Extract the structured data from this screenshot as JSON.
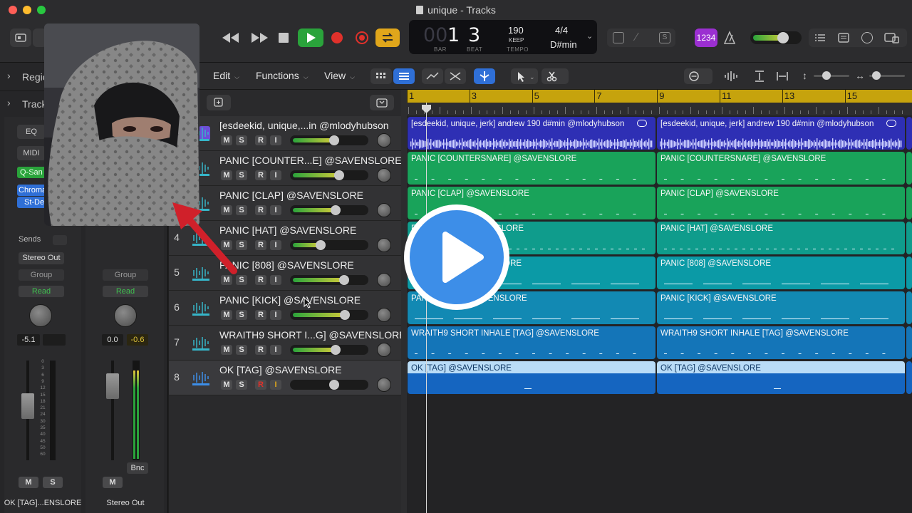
{
  "window": {
    "title": "unique - Tracks"
  },
  "transport": {
    "bar": "1",
    "beat": "3",
    "bar_label": "BAR",
    "beat_label": "BEAT",
    "tempo": "190",
    "tempo_mode": "KEEP",
    "tempo_label": "TEMPO",
    "signature": "4/4",
    "key": "D#min"
  },
  "lcd_toggle": {
    "label": "1234"
  },
  "menus": {
    "edit": "Edit",
    "functions": "Functions",
    "view": "View"
  },
  "inspector": {
    "region_header": "Regio",
    "track_header": "Track",
    "eq_label": "EQ",
    "midi_label": "MIDI",
    "qsampler_label": "Q-San",
    "chroma_label": "Chroma",
    "stdelay_label": "St-De",
    "sends_label": "Sends",
    "output_label": "Stereo Out",
    "group_label": "Group",
    "automation_left": "Read",
    "automation_right": "Read",
    "vol_left": "-5.1",
    "vol_right_a": "0.0",
    "vol_right_b": "-0.6",
    "mute_left": "M",
    "solo_left": "S",
    "mute_right": "M",
    "bounce": "Bnc",
    "strip_left_name": "OK [TAG]...ENSLORE",
    "strip_right_name": "Stereo Out",
    "meter_scale": [
      "0",
      "3",
      "6",
      "9",
      "12",
      "15",
      "18",
      "21",
      "24",
      "30",
      "35",
      "40",
      "45",
      "50",
      "60"
    ]
  },
  "tracks": [
    {
      "num": "",
      "name": "[esdeekid, unique,...in @mlodyhubson",
      "region": "[esdeekid, unique, jerk] andrew 190 d#min @mlodyhubson",
      "color": "#2e2fb4",
      "vol": 0.55
    },
    {
      "num": "",
      "name": "PANIC [COUNTER...E] @SAVENSLORE",
      "region": "PANIC [COUNTERSNARE] @SAVENSLORE",
      "color": "#19a35a",
      "vol": 0.62
    },
    {
      "num": "",
      "name": "PANIC [CLAP] @SAVENSLORE",
      "region": "PANIC [CLAP] @SAVENSLORE",
      "color": "#19a35a",
      "vol": 0.57
    },
    {
      "num": "4",
      "name": "PANIC [HAT] @SAVENSLORE",
      "region": "PANIC [HAT] @SAVENSLORE",
      "color": "#0f9c8c",
      "vol": 0.36
    },
    {
      "num": "5",
      "name": "PANIC [808] @SAVENSLORE",
      "region": "PANIC [808] @SAVENSLORE",
      "color": "#0b9aa6",
      "vol": 0.69
    },
    {
      "num": "6",
      "name": "PANIC [KICK] @SAVENSLORE",
      "region": "PANIC [KICK] @SAVENSLORE",
      "color": "#1289b3",
      "vol": 0.7
    },
    {
      "num": "7",
      "name": "WRAITH9 SHORT I...G] @SAVENSLORE",
      "region": "WRAITH9 SHORT INHALE [TAG] @SAVENSLORE",
      "color": "#1475b8",
      "vol": 0.57
    },
    {
      "num": "8",
      "name": "OK [TAG] @SAVENSLORE",
      "region": "OK [TAG] @SAVENSLORE",
      "color": "#1565c0",
      "vol": 0.55
    }
  ],
  "ruler": [
    "1",
    "3",
    "5",
    "7",
    "9",
    "11",
    "13",
    "15"
  ],
  "colors": {
    "ruler": "#c6a30d",
    "play": "#2aa33b",
    "record": "#e0312b",
    "cycle": "#e0a61b",
    "accent_purple": "#9b2fd1"
  }
}
